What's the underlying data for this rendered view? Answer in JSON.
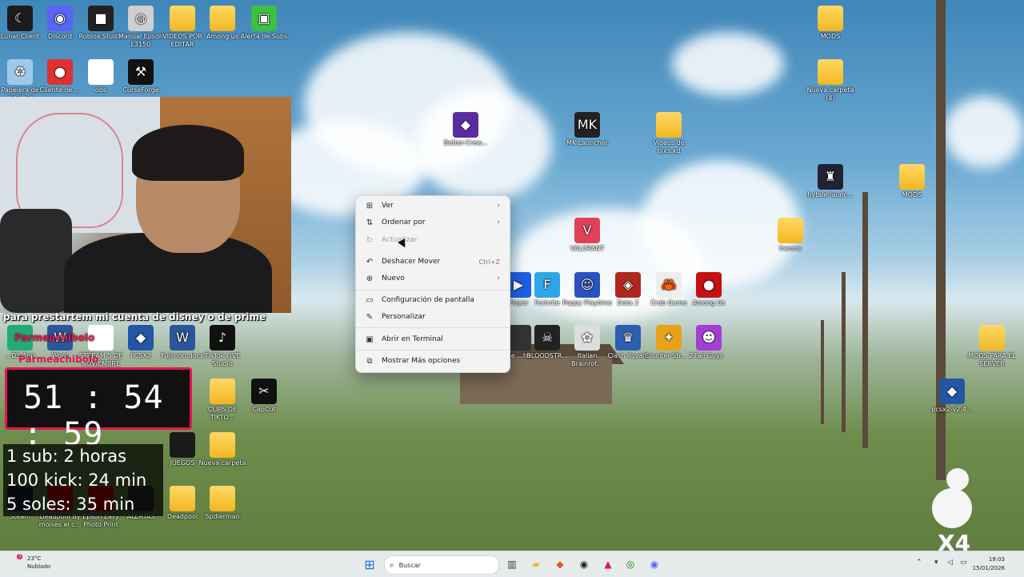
{
  "desktop_icons": [
    {
      "label": "Lunar Client",
      "color": "#1c1c1c",
      "glyph": "☾"
    },
    {
      "label": "Discord",
      "color": "#5865f2",
      "glyph": "◉"
    },
    {
      "label": "Roblox Studio",
      "color": "#222",
      "glyph": "■"
    },
    {
      "label": "Manual Epson L3150",
      "color": "#cfcfcf",
      "glyph": "◍"
    },
    {
      "label": "VIDEOS POR EDITAR",
      "color": "folder",
      "glyph": ""
    },
    {
      "label": "Among us",
      "color": "folder",
      "glyph": ""
    },
    {
      "label": "Alerta de Subs",
      "color": "#3fbf3f",
      "glyph": "▣"
    },
    {
      "label": "Papelera de reciclaje",
      "color": "#9ec9ea",
      "glyph": "♻"
    },
    {
      "label": "Cliente de ...",
      "color": "#e03131",
      "glyph": "●"
    },
    {
      "label": "obs",
      "color": "#fff",
      "glyph": ""
    },
    {
      "label": "CurseForge",
      "color": "#111",
      "glyph": "⚒"
    },
    {
      "label": "MODS",
      "color": "folder",
      "glyph": ""
    },
    {
      "label": "Nueva carpeta (4)",
      "color": "folder",
      "glyph": ""
    },
    {
      "label": "Better-Crew...",
      "color": "#5a2ca0",
      "glyph": "◆"
    },
    {
      "label": "MK Launcher",
      "color": "#222",
      "glyph": "MK"
    },
    {
      "label": "Videos de bixs.xd",
      "color": "folder",
      "glyph": ""
    },
    {
      "label": "hytale-launc...",
      "color": "#223",
      "glyph": "♜"
    },
    {
      "label": "MODS",
      "color": "folder",
      "glyph": ""
    },
    {
      "label": "VALORANT",
      "color": "#e14156",
      "glyph": "V"
    },
    {
      "label": "frenms",
      "color": "folder",
      "glyph": ""
    },
    {
      "label": "Player",
      "color": "#1e5fe0",
      "glyph": "▶"
    },
    {
      "label": "Fortnite",
      "color": "#2ea7e8",
      "glyph": "F"
    },
    {
      "label": "Poppy Playtime",
      "color": "#2a52c0",
      "glyph": "☺"
    },
    {
      "label": "Dota 2",
      "color": "#b0271e",
      "glyph": "◈"
    },
    {
      "label": "Crab Game",
      "color": "#eee",
      "glyph": "🦀"
    },
    {
      "label": "Among Us",
      "color": "#c51111",
      "glyph": "●"
    },
    {
      "label": "...le ...her",
      "color": "#333",
      "glyph": ""
    },
    {
      "label": "BLOODSTR...",
      "color": "#222",
      "glyph": "☠"
    },
    {
      "label": "Italian Brainrot...",
      "color": "#ddd",
      "glyph": "✿"
    },
    {
      "label": "Clash Royale",
      "color": "#2c5fb0",
      "glyph": "♛"
    },
    {
      "label": "Counter-Str... 2",
      "color": "#e8a21a",
      "glyph": "✦"
    },
    {
      "label": "Fall Guys",
      "color": "#a43ed6",
      "glyph": "☻"
    },
    {
      "label": "MODS PARA EL SERVER",
      "color": "folder",
      "glyph": ""
    },
    {
      "label": "pcsx2-v2.4...",
      "color": "#2456a6",
      "glyph": "◆"
    },
    {
      "label": "...DS App",
      "color": "#2a7",
      "glyph": ""
    },
    {
      "label": "Word",
      "color": "#2b579a",
      "glyph": "W"
    },
    {
      "label": "STREAM 5 DE NOVIEMBRE",
      "color": "#fff",
      "glyph": ""
    },
    {
      "label": "PCSX2",
      "color": "#2456a6",
      "glyph": "◆"
    },
    {
      "label": "Fujimori.docx",
      "color": "#2b579a",
      "glyph": "W"
    },
    {
      "label": "TikTok LIVE Studio",
      "color": "#111",
      "glyph": "♪"
    },
    {
      "label": "CLIPS DE TIKTO...",
      "color": "folder",
      "glyph": ""
    },
    {
      "label": "CapCut",
      "color": "#111",
      "glyph": "✂"
    },
    {
      "label": "JUEGOS",
      "color": "#1a1a1a",
      "glyph": ""
    },
    {
      "label": "Nueva carpeta",
      "color": "folder",
      "glyph": ""
    },
    {
      "label": "Steam",
      "color": "#1b2838",
      "glyph": ""
    },
    {
      "label": "Deadpool By moises el c...",
      "color": "#c00",
      "glyph": ""
    },
    {
      "label": "Epson Easy Photo Print",
      "color": "#c00",
      "glyph": ""
    },
    {
      "label": "ALERTAS",
      "color": "#333",
      "glyph": ""
    },
    {
      "label": "Deadpool",
      "color": "folder",
      "glyph": ""
    },
    {
      "label": "Spdierman",
      "color": "folder",
      "glyph": ""
    }
  ],
  "stream": {
    "caption": "para prestartem mi cuenta de disney o de prime",
    "timer_name": "Parmeachibolo",
    "timer": "51 : 54 : 59",
    "goals": [
      "1 sub: 2 horas",
      "100 kick: 24 min",
      "5 soles: 35 min"
    ],
    "multiplier": "X4"
  },
  "context_menu": {
    "items": [
      {
        "label": "Ver",
        "icon": "grid-icon",
        "glyph": "⊞",
        "submenu": true,
        "disabled": false,
        "shortcut": ""
      },
      {
        "label": "Ordenar por",
        "icon": "sort-icon",
        "glyph": "⇅",
        "submenu": true,
        "disabled": false,
        "shortcut": ""
      },
      {
        "label": "Actualizar",
        "icon": "refresh-icon",
        "glyph": "↻",
        "submenu": false,
        "disabled": true,
        "shortcut": ""
      },
      {
        "label": "Deshacer Mover",
        "icon": "undo-icon",
        "glyph": "↶",
        "submenu": false,
        "disabled": false,
        "shortcut": "Ctrl+Z"
      },
      {
        "label": "Nuevo",
        "icon": "plus-icon",
        "glyph": "⊕",
        "submenu": true,
        "disabled": false,
        "shortcut": ""
      },
      {
        "label": "Configuración de pantalla",
        "icon": "display-icon",
        "glyph": "▭",
        "submenu": false,
        "disabled": false,
        "shortcut": ""
      },
      {
        "label": "Personalizar",
        "icon": "brush-icon",
        "glyph": "✎",
        "submenu": false,
        "disabled": false,
        "shortcut": ""
      },
      {
        "label": "Abrir en Terminal",
        "icon": "terminal-icon",
        "glyph": "▣",
        "submenu": false,
        "disabled": false,
        "shortcut": ""
      },
      {
        "label": "Mostrar Más opciones",
        "icon": "more-options-icon",
        "glyph": "⧉",
        "submenu": false,
        "disabled": false,
        "shortcut": ""
      }
    ]
  },
  "taskbar": {
    "weather_temp": "23°C",
    "weather_desc": "Nublado",
    "weather_badge": "3",
    "search_placeholder": "Buscar",
    "time": "19:03",
    "date": "15/01/2026",
    "apps": [
      {
        "name": "start-icon",
        "glyph": "⊞",
        "color": "#1f6fd6"
      },
      {
        "name": "task-view-icon",
        "glyph": "▥",
        "color": "#333"
      },
      {
        "name": "file-explorer-icon",
        "glyph": "▰",
        "color": "#f2b71f"
      },
      {
        "name": "brave-icon",
        "glyph": "◆",
        "color": "#e8502a"
      },
      {
        "name": "obs-icon",
        "glyph": "◉",
        "color": "#222"
      },
      {
        "name": "adobe-icon",
        "glyph": "▲",
        "color": "#e4164f"
      },
      {
        "name": "xbox-icon",
        "glyph": "◎",
        "color": "#107c10"
      },
      {
        "name": "discord-icon",
        "glyph": "◉",
        "color": "#5865f2"
      }
    ]
  }
}
